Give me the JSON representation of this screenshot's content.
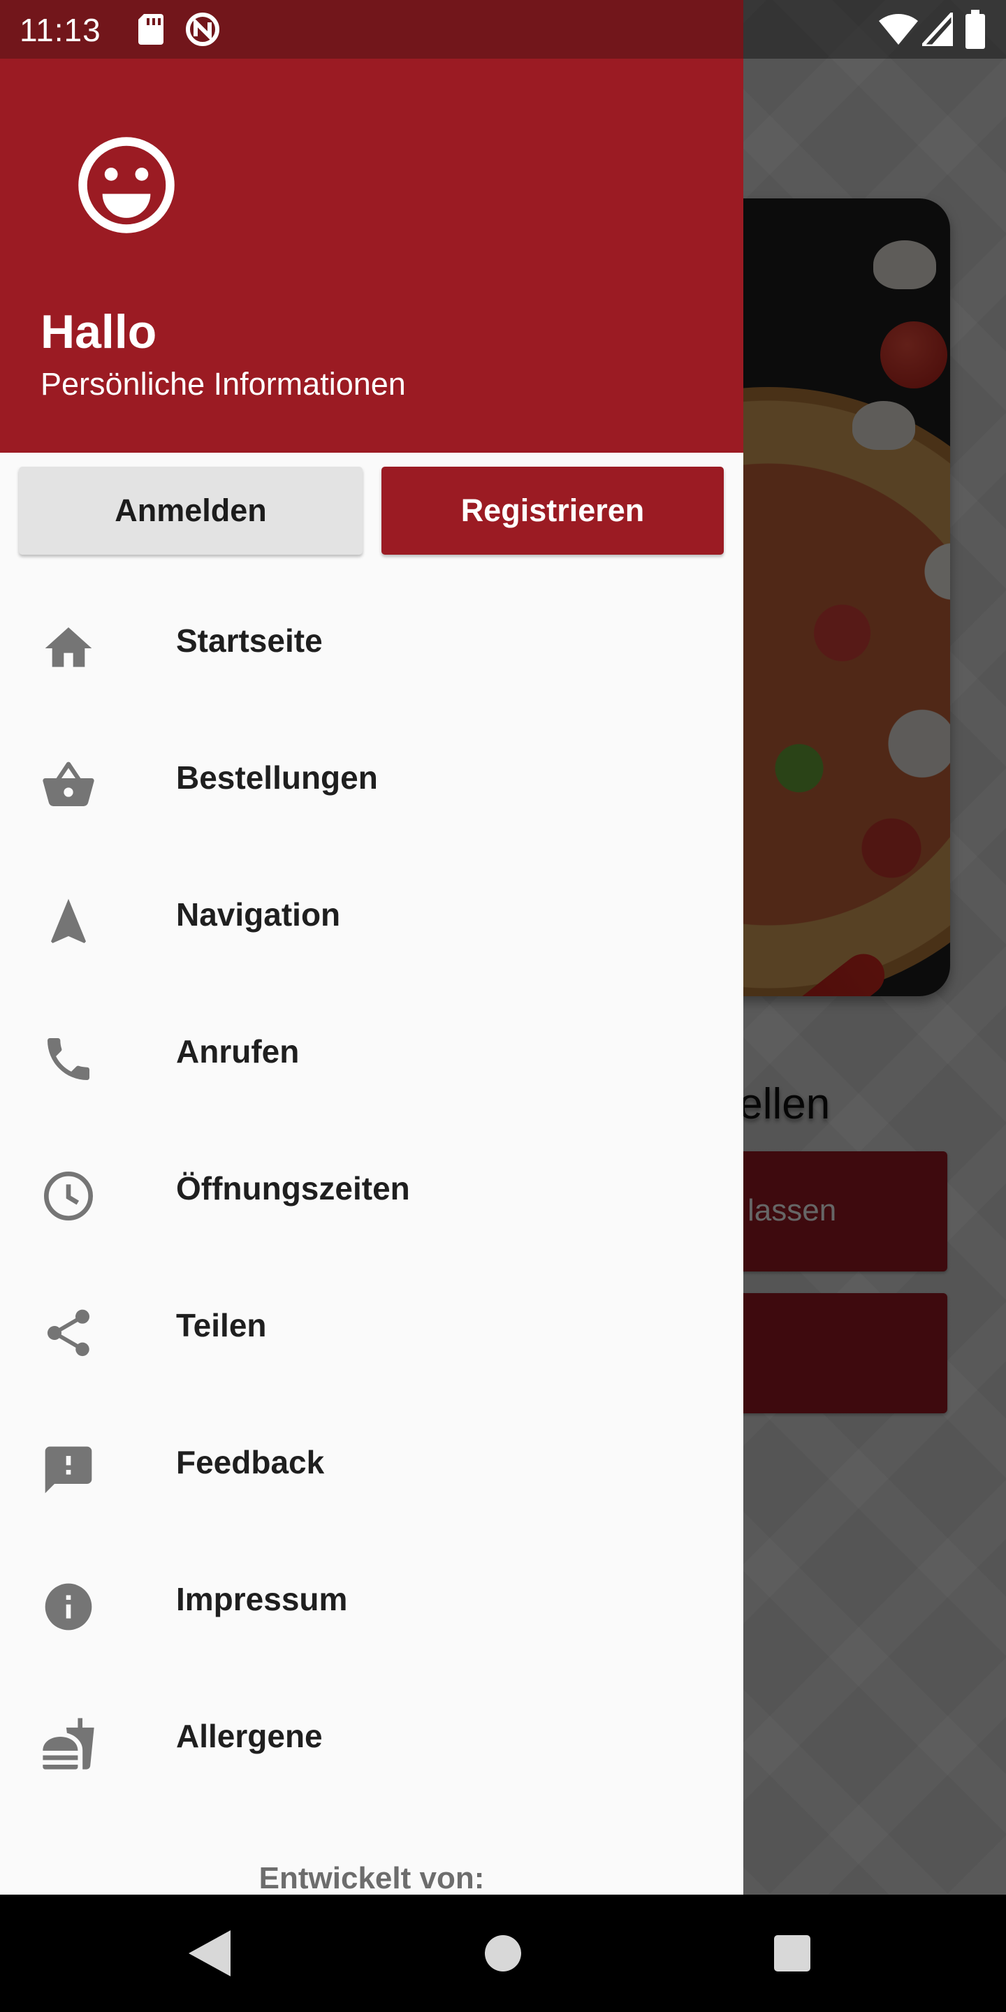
{
  "status_bar": {
    "time": "11:13",
    "icons": [
      "sd-card-icon",
      "nfc-icon",
      "wifi-icon",
      "signal-icon",
      "battery-icon"
    ]
  },
  "drawer": {
    "header": {
      "avatar_icon": "smiley-face-icon",
      "greeting": "Hallo",
      "subtitle": "Persönliche Informationen",
      "background_color": "#9b1b23"
    },
    "buttons": {
      "login_label": "Anmelden",
      "register_label": "Registrieren"
    },
    "menu": [
      {
        "label": "Startseite",
        "icon": "home-icon"
      },
      {
        "label": "Bestellungen",
        "icon": "shopping-basket-icon"
      },
      {
        "label": "Navigation",
        "icon": "navigation-arrow-icon"
      },
      {
        "label": "Anrufen",
        "icon": "phone-icon"
      },
      {
        "label": "Öffnungszeiten",
        "icon": "clock-icon"
      },
      {
        "label": "Teilen",
        "icon": "share-icon"
      },
      {
        "label": "Feedback",
        "icon": "feedback-icon"
      },
      {
        "label": "Impressum",
        "icon": "info-icon"
      },
      {
        "label": "Allergene",
        "icon": "fastfood-icon"
      }
    ],
    "footer": "Entwickelt von:"
  },
  "background_screen": {
    "heading_fragment": "tellen",
    "button_fragment": "lassen"
  },
  "colors": {
    "accent": "#9b1b23",
    "status_bar": "#72161b",
    "icon_gray": "#757575"
  }
}
